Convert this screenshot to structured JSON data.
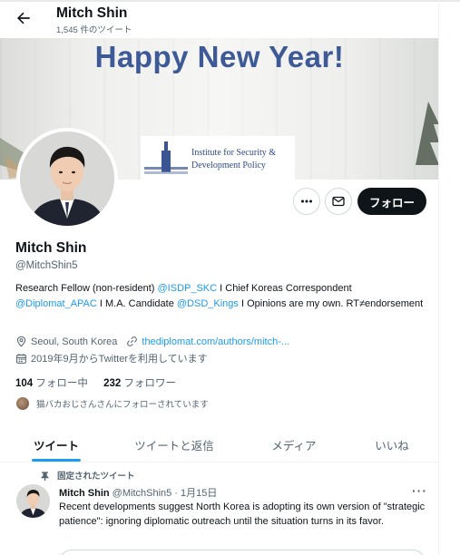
{
  "header": {
    "name": "Mitch Shin",
    "tweet_count": "1,545 件のツイート",
    "back_icon": "arrow-left-icon"
  },
  "banner": {
    "title": "Happy New Year!",
    "institute_line1": "Institute for Security &",
    "institute_line2": "Development Policy"
  },
  "profile": {
    "name": "Mitch Shin",
    "handle": "@MitchShin5",
    "follow_label": "フォロー",
    "bio": {
      "t1": "Research Fellow (non-resident) ",
      "l1": "@ISDP_SKC",
      "t2": " I Chief Koreas Correspondent ",
      "l2": "@Diplomat_APAC",
      "t3": " I M.A. Candidate ",
      "l3": "@DSD_Kings",
      "t4": " I Opinions are my own. RT≠endorsement"
    },
    "location": "Seoul, South Korea",
    "website": "thediplomat.com/authors/mitch-...",
    "joined": "2019年9月からTwitterを利用しています",
    "following_count": "104",
    "following_label": "フォロー中",
    "followers_count": "232",
    "followers_label": "フォロワー",
    "followed_by": "猫バカおじさんさんにフォローされています"
  },
  "tabs": [
    {
      "label": "ツイート",
      "active": true
    },
    {
      "label": "ツイートと返信",
      "active": false
    },
    {
      "label": "メディア",
      "active": false
    },
    {
      "label": "いいね",
      "active": false
    }
  ],
  "pinned_tweet": {
    "pinned_label": "固定されたツイート",
    "author_name": "Mitch Shin",
    "author_meta": "@MitchShin5 · 1月15日",
    "more": "···",
    "text": "Recent developments suggest North Korea is adopting its own version of \"strategic patience\": ignoring diplomatic outreach until the situation turns in its favor."
  },
  "colors": {
    "accent": "#1d9bf0",
    "banner_text": "#3d5a96",
    "follow_button": "#0f1419"
  }
}
